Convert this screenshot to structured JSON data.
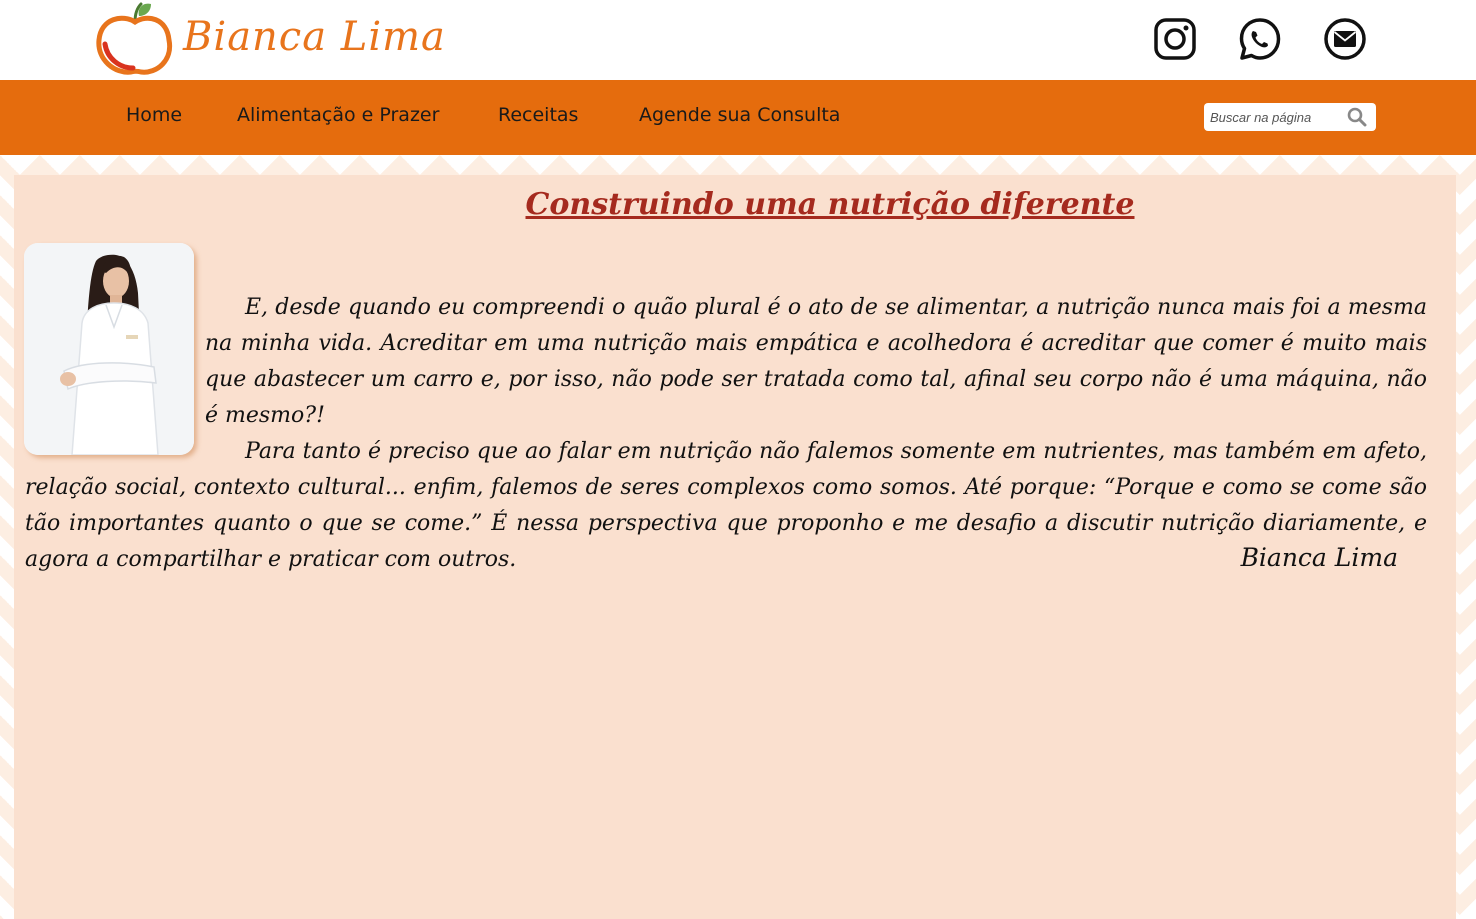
{
  "brand": {
    "name": "Bianca Lima",
    "logo_icon": "apple-logo-icon",
    "accent_color": "#e56c0d",
    "logo_text_color": "#e8741c"
  },
  "social": [
    {
      "name": "instagram",
      "icon": "instagram-icon"
    },
    {
      "name": "whatsapp",
      "icon": "whatsapp-icon"
    },
    {
      "name": "email",
      "icon": "email-icon"
    }
  ],
  "nav": {
    "items": [
      {
        "label": "Home"
      },
      {
        "label": "Alimentação e Prazer"
      },
      {
        "label": "Receitas"
      },
      {
        "label": "Agende sua Consulta"
      }
    ],
    "background_color": "#e56c0d"
  },
  "search": {
    "placeholder": "Buscar na página",
    "icon": "search-icon"
  },
  "article": {
    "title": "Construindo uma nutrição diferente",
    "title_color": "#a52a1e",
    "paragraphs": [
      "E, desde quando eu compreendi o quão plural é o ato de se alimentar, a nutrição nunca mais foi a mesma na minha vida. Acreditar em uma nutrição mais empática e acolhedora é acreditar que comer é muito mais que abastecer um carro e, por isso, não pode ser tratada como tal, afinal seu corpo não é uma máquina, não é mesmo?!",
      "Para tanto é preciso que ao falar em nutrição não falemos somente em nutrientes, mas também em afeto, relação social, contexto cultural... enfim, falemos de seres complexos como somos. Até porque: “Porque e como se come são tão importantes quanto o que se come.” É nessa perspectiva que proponho e me desafio a discutir nutrição diariamente, e agora a compartilhar e praticar com outros."
    ],
    "signature": "Bianca Lima",
    "background_color": "#fae0cf"
  }
}
